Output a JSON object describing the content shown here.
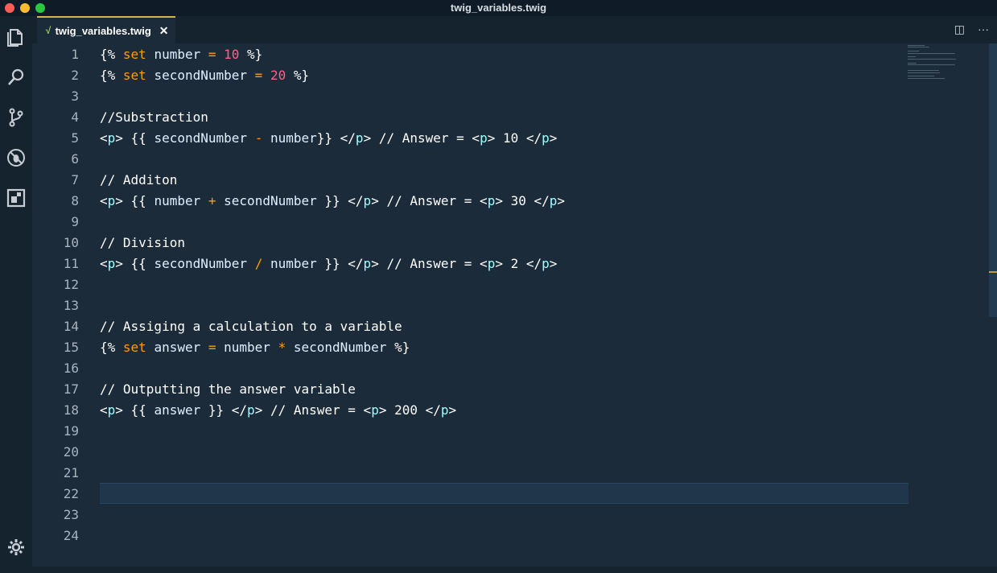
{
  "window": {
    "title": "twig_variables.twig"
  },
  "tabs": [
    {
      "label": "twig_variables.twig",
      "close": "✕"
    }
  ],
  "tab_actions": {
    "split": "◫",
    "more": "···"
  },
  "activity_icons": [
    "files-icon",
    "search-icon",
    "source-control-icon",
    "debug-icon",
    "extensions-icon"
  ],
  "colors": {
    "background": "#1b2b3a",
    "keyword": "#ff9d00",
    "number": "#ff628c",
    "tag": "#9effff",
    "text": "#ffffff",
    "tab_accent": "#d9b44a"
  },
  "editor": {
    "line_numbers": [
      "1",
      "2",
      "3",
      "4",
      "5",
      "6",
      "7",
      "8",
      "9",
      "10",
      "11",
      "12",
      "13",
      "14",
      "15",
      "16",
      "17",
      "18",
      "19",
      "20",
      "21",
      "22",
      "23",
      "24"
    ],
    "current_line": 22,
    "lines": [
      [
        [
          "{% ",
          "t-punct"
        ],
        [
          "set ",
          "t-kw"
        ],
        [
          "number ",
          "t-var"
        ],
        [
          "= ",
          "t-op"
        ],
        [
          "10",
          "t-num"
        ],
        [
          " %}",
          "t-punct"
        ]
      ],
      [
        [
          "{% ",
          "t-punct"
        ],
        [
          "set ",
          "t-kw"
        ],
        [
          "secondNumber ",
          "t-var"
        ],
        [
          "= ",
          "t-op"
        ],
        [
          "20",
          "t-num"
        ],
        [
          " %}",
          "t-punct"
        ]
      ],
      [],
      [
        [
          "//Substraction",
          "t-text"
        ]
      ],
      [
        [
          "<",
          "t-punct"
        ],
        [
          "p",
          "t-tag"
        ],
        [
          "> {{ ",
          "t-punct"
        ],
        [
          "secondNumber ",
          "t-var"
        ],
        [
          "- ",
          "t-op"
        ],
        [
          "number",
          "t-var"
        ],
        [
          "}} </",
          "t-punct"
        ],
        [
          "p",
          "t-tag"
        ],
        [
          "> // Answer = <",
          "t-text"
        ],
        [
          "p",
          "t-tag"
        ],
        [
          "> 10 </",
          "t-text"
        ],
        [
          "p",
          "t-tag"
        ],
        [
          ">",
          "t-text"
        ]
      ],
      [],
      [
        [
          "// Additon",
          "t-text"
        ]
      ],
      [
        [
          "<",
          "t-punct"
        ],
        [
          "p",
          "t-tag"
        ],
        [
          "> {{ ",
          "t-punct"
        ],
        [
          "number ",
          "t-var"
        ],
        [
          "+ ",
          "t-op"
        ],
        [
          "secondNumber",
          "t-var"
        ],
        [
          " }} </",
          "t-punct"
        ],
        [
          "p",
          "t-tag"
        ],
        [
          "> // Answer = <",
          "t-text"
        ],
        [
          "p",
          "t-tag"
        ],
        [
          "> 30 </",
          "t-text"
        ],
        [
          "p",
          "t-tag"
        ],
        [
          ">",
          "t-text"
        ]
      ],
      [],
      [
        [
          "// Division",
          "t-text"
        ]
      ],
      [
        [
          "<",
          "t-punct"
        ],
        [
          "p",
          "t-tag"
        ],
        [
          "> {{ ",
          "t-punct"
        ],
        [
          "secondNumber ",
          "t-var"
        ],
        [
          "/ ",
          "t-op"
        ],
        [
          "number",
          "t-var"
        ],
        [
          " }} </",
          "t-punct"
        ],
        [
          "p",
          "t-tag"
        ],
        [
          "> // Answer = <",
          "t-text"
        ],
        [
          "p",
          "t-tag"
        ],
        [
          "> 2 </",
          "t-text"
        ],
        [
          "p",
          "t-tag"
        ],
        [
          ">",
          "t-text"
        ]
      ],
      [],
      [],
      [
        [
          "// Assiging a calculation to a variable",
          "t-text"
        ]
      ],
      [
        [
          "{% ",
          "t-punct"
        ],
        [
          "set ",
          "t-kw"
        ],
        [
          "answer ",
          "t-var"
        ],
        [
          "= ",
          "t-op"
        ],
        [
          "number ",
          "t-var"
        ],
        [
          "* ",
          "t-op"
        ],
        [
          "secondNumber",
          "t-var"
        ],
        [
          " %}",
          "t-punct"
        ]
      ],
      [],
      [
        [
          "// Outputting the answer variable",
          "t-text"
        ]
      ],
      [
        [
          "<",
          "t-punct"
        ],
        [
          "p",
          "t-tag"
        ],
        [
          "> {{ ",
          "t-punct"
        ],
        [
          "answer",
          "t-var"
        ],
        [
          " }} </",
          "t-punct"
        ],
        [
          "p",
          "t-tag"
        ],
        [
          "> // Answer = <",
          "t-text"
        ],
        [
          "p",
          "t-tag"
        ],
        [
          "> 200 </",
          "t-text"
        ],
        [
          "p",
          "t-tag"
        ],
        [
          ">",
          "t-text"
        ]
      ],
      [],
      [],
      [],
      [],
      [],
      []
    ]
  }
}
